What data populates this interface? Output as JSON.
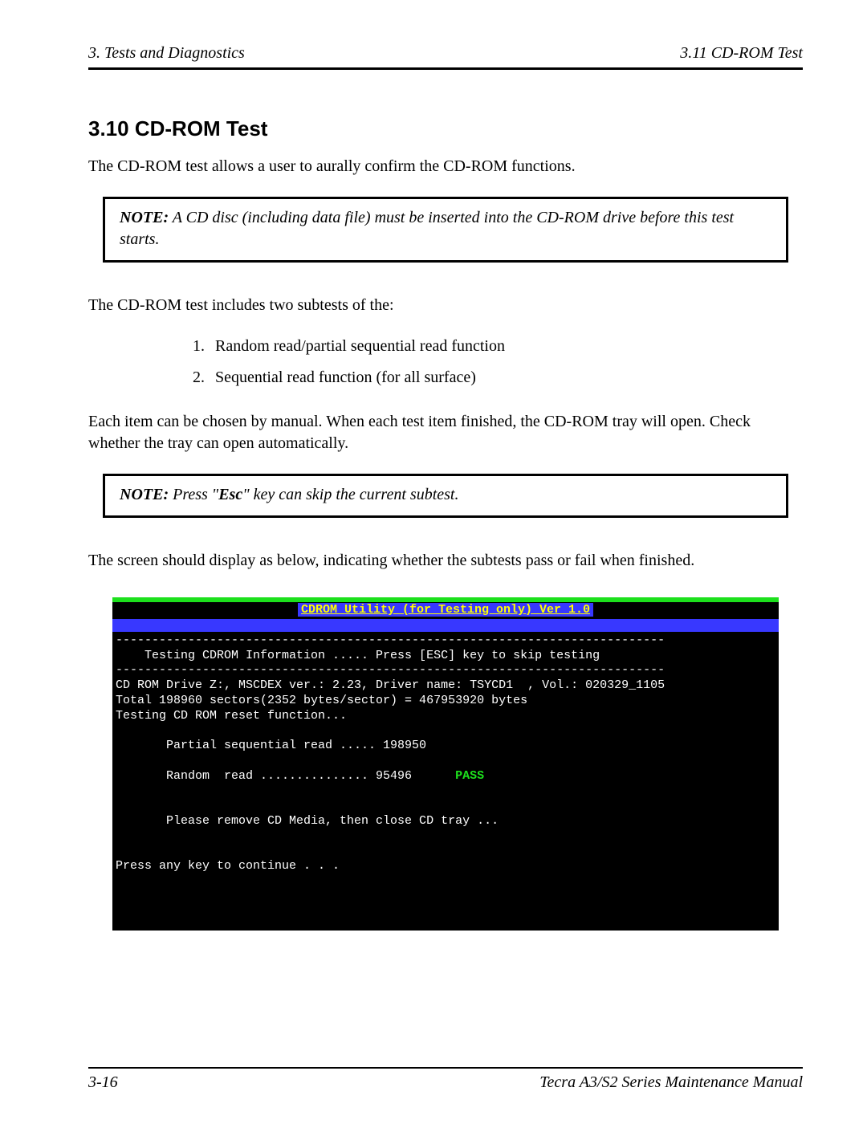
{
  "header": {
    "left": "3.  Tests and Diagnostics",
    "right": "3.11  CD-ROM Test"
  },
  "section": {
    "number_title": "3.10  CD-ROM Test",
    "intro": "The CD-ROM test allows a user to aurally confirm the CD-ROM functions.",
    "note1_label": "NOTE:",
    "note1_text": "  A CD disc (including data file) must be inserted into the CD-ROM drive before this test starts.",
    "subtests_intro": "The CD-ROM test includes two subtests of the:",
    "subtests": [
      "Random read/partial sequential read function",
      "Sequential read function (for all surface)"
    ],
    "after_list": "Each item can be chosen by manual. When each test item finished, the CD-ROM tray will open. Check whether the tray can open automatically.",
    "note2_label": "NOTE:",
    "note2_text_prefix": "  Press \"",
    "note2_key": "Esc",
    "note2_text_suffix": "\" key can skip the current subtest.",
    "screen_intro": "The screen should display as below, indicating whether the subtests pass or fail when finished."
  },
  "terminal": {
    "title": "CDROM Utility (for Testing only)  Ver 1.0",
    "dash_line": "----------------------------------------------------------------------------",
    "info_line": "    Testing CDROM Information ..... Press [ESC] key to skip testing",
    "drive_line": "CD ROM Drive Z:, MSCDEX ver.: 2.23, Driver name: TSYCD1  , Vol.: 020329_1105",
    "total_line": "Total 198960 sectors(2352 bytes/sector) = 467953920 bytes",
    "reset_line": "Testing CD ROM reset function...",
    "partial_line": "       Partial sequential read ..... 198950",
    "random_line_prefix": "       Random  read ............... 95496      ",
    "random_pass": "PASS",
    "remove_line": "       Please remove CD Media, then close CD tray ...",
    "press_line": "Press any key to continue . . ."
  },
  "footer": {
    "left": "3-16",
    "right": "Tecra A3/S2 Series Maintenance Manual"
  }
}
